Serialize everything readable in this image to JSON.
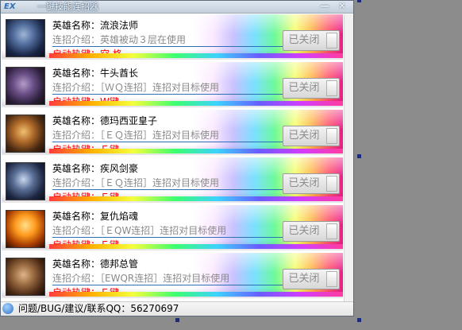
{
  "window": {
    "title": "一键技能连招器",
    "logo_text": "EX",
    "minimize_glyph": "—",
    "close_glyph": "✕"
  },
  "rows": [
    {
      "hero_prefix": "英雄名称：",
      "hero_name": "流浪法师",
      "combo_text": "连招介绍：英雄被动３层在使用",
      "hotkey_text": "启动热键：空 格",
      "toggle_label": "已关闭",
      "toggle_on": false,
      "avatar_icon": "ryze-portrait-icon"
    },
    {
      "hero_prefix": "英雄名称：",
      "hero_name": "牛头酋长",
      "combo_text": "连招介绍：［ＷＱ连招］连招对目标使用",
      "hotkey_text": "启动热键：W键",
      "toggle_label": "已关闭",
      "toggle_on": false,
      "avatar_icon": "alistar-portrait-icon"
    },
    {
      "hero_prefix": "英雄名称：",
      "hero_name": "德玛西亚皇子",
      "combo_text": "连招介绍：［ＥＱ连招］连招对目标使用",
      "hotkey_text": "启动热键：Ｅ键",
      "toggle_label": "已关闭",
      "toggle_on": false,
      "avatar_icon": "jarvan-portrait-icon"
    },
    {
      "hero_prefix": "英雄名称：",
      "hero_name": "疾风剑豪",
      "combo_text": "连招介绍：［ＥＱ连招］连招对目标使用",
      "hotkey_text": "启动热键：Ｅ键",
      "toggle_label": "已关闭",
      "toggle_on": false,
      "avatar_icon": "yasuo-portrait-icon"
    },
    {
      "hero_prefix": "英雄名称：",
      "hero_name": "复仇焰魂",
      "combo_text": "连招介绍：［ＥQW连招］连招对目标使用",
      "hotkey_text": "启动热键：Ｅ键",
      "toggle_label": "已关闭",
      "toggle_on": false,
      "avatar_icon": "brand-portrait-icon"
    },
    {
      "hero_prefix": "英雄名称：",
      "hero_name": "德邦总管",
      "combo_text": "连招介绍：［EWQR连招］连招对目标使用",
      "hotkey_text": "启动热键：Ｅ键",
      "toggle_label": "已关闭",
      "toggle_on": false,
      "avatar_icon": "xin-zhao-portrait-icon"
    }
  ],
  "statusbar": {
    "icon": "speaker-icon",
    "text": "问题/BUG/建议/联系QQ：56270697"
  },
  "colors": {
    "title_text": "#ffffff",
    "hero_name": "#000000",
    "combo_text": "#8a8a8a",
    "hotkey_text": "#ff0000",
    "toggle_label": "#8c8c8c",
    "selection_handle": "#1e2a7a",
    "backdrop": "#8c8c8c"
  }
}
